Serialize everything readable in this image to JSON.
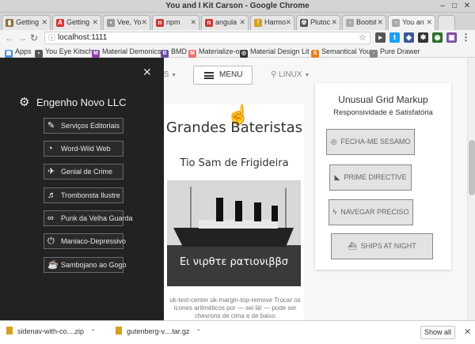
{
  "window": {
    "title": "You and I Kit Carson - Google Chrome"
  },
  "tabs": [
    {
      "label": "Getting",
      "icon": "book-icon",
      "color": "#8b6f3a"
    },
    {
      "label": "Getting",
      "icon": "angular-icon",
      "color": "#dd3333"
    },
    {
      "label": "Vee, Yo",
      "icon": "generic-tab-icon",
      "color": "#999999"
    },
    {
      "label": "npm",
      "icon": "npm-icon",
      "color": "#cb3837"
    },
    {
      "label": "angula",
      "icon": "npm-icon",
      "color": "#cb3837"
    },
    {
      "label": "Harmo",
      "icon": "bulb-icon",
      "color": "#d4a020"
    },
    {
      "label": "Plutoc",
      "icon": "hazard-icon",
      "color": "#555555"
    },
    {
      "label": "Bootst",
      "icon": "page-icon",
      "color": "#aaaaaa"
    },
    {
      "label": "You an",
      "icon": "page-icon",
      "color": "#aaaaaa",
      "active": true
    }
  ],
  "omnibox": {
    "url": "localhost:1111"
  },
  "bookmarks": [
    {
      "label": "Apps",
      "color": "#4a90d9"
    },
    {
      "label": "You Eye Kitsch",
      "color": "#555555"
    },
    {
      "label": "Material Demonics",
      "color": "#8e44ad"
    },
    {
      "label": "BMD",
      "color": "#6a4c9c"
    },
    {
      "label": "Materialize-o",
      "color": "#ee6e73"
    },
    {
      "label": "Material Design Lit",
      "color": "#333333"
    },
    {
      "label": "Semantical You",
      "color": "#e67e22"
    },
    {
      "label": "Pure Drawer",
      "color": "#888888"
    }
  ],
  "topnav": {
    "left_label": "AS",
    "menu_label": "MENU",
    "right_label": "LINUX"
  },
  "sidenav": {
    "brand": "Engenho Novo LLC",
    "items": [
      {
        "label": "Serviços Editoriais",
        "icon": "pencil-icon"
      },
      {
        "label": "Word-Wild Web",
        "icon": "satellite-dish-icon"
      },
      {
        "label": "Genial de Crime",
        "icon": "airplane-icon"
      },
      {
        "label": "Trombonsta Ilustre",
        "icon": "playlist-icon"
      },
      {
        "label": "Punk da Velha Guarda",
        "icon": "infinity-icon"
      },
      {
        "label": "Maniaco-Depressivo",
        "icon": "power-icon"
      },
      {
        "label": "Sambojano ao Gogo",
        "icon": "coffee-icon"
      }
    ]
  },
  "card1": {
    "title": "Grandes Bateristas",
    "subtitle": "Tio Sam de Frigideira",
    "image_caption": "Ει νιρθτε ρατιονιββσ",
    "body": "uk-text-center uk-margin-top-remove Trocar os ícones aritméticos por — sei lá! — pode ser chevrons de cima e de baixo"
  },
  "card2": {
    "title": "Unusual Grid Markup",
    "subtitle": "Responsividade é Satisfatória",
    "buttons": [
      {
        "label": "FECHA-ME SESAMO",
        "icon": "disc-icon"
      },
      {
        "label": "PRIME DIRECTIVE",
        "icon": "shoe-icon"
      },
      {
        "label": "NAVEGAR PRECISO",
        "icon": "bolt-icon"
      },
      {
        "label": "SHIPS AT NIGHT",
        "icon": "ship-icon"
      }
    ]
  },
  "downloads": {
    "items": [
      {
        "label": "sidenav-with-co....zip"
      },
      {
        "label": "gutenberg-v....tar.gz"
      }
    ],
    "show_all": "Show all"
  }
}
